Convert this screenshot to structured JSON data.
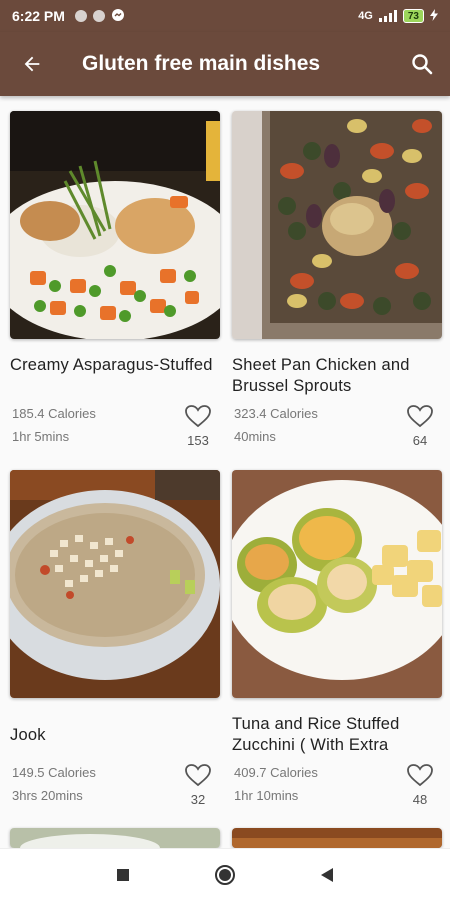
{
  "status": {
    "time": "6:22 PM",
    "network": "4G",
    "battery": "73"
  },
  "app_bar": {
    "title": "Gluten free main dishes",
    "back_icon": "arrow-left-icon",
    "search_icon": "search-icon"
  },
  "recipes": [
    {
      "name": "Creamy Asparagus-Stuffed",
      "calories": "185.4 Calories",
      "time": "1hr 5mins",
      "likes": "153"
    },
    {
      "name": "Sheet Pan Chicken and Brussel Sprouts",
      "calories": "323.4 Calories",
      "time": "40mins",
      "likes": "64"
    },
    {
      "name": "Jook",
      "calories": "149.5 Calories",
      "time": "3hrs 20mins",
      "likes": "32"
    },
    {
      "name": "Tuna and Rice Stuffed Zucchini ( With Extra",
      "calories": "409.7 Calories",
      "time": "1hr 10mins",
      "likes": "48"
    }
  ],
  "colors": {
    "app_bar": "#6b4a3c",
    "background": "#fafafa"
  }
}
